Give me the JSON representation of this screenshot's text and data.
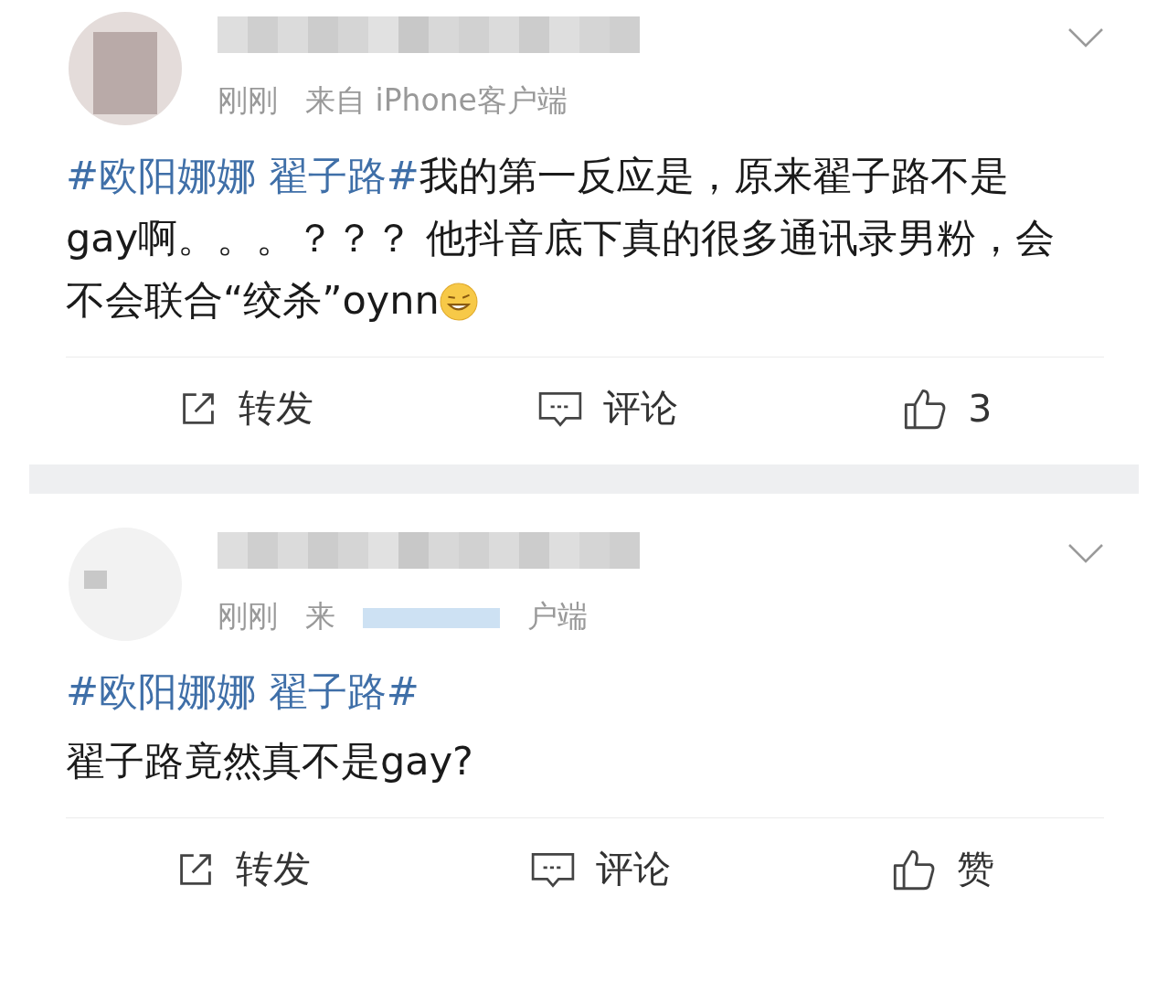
{
  "posts": [
    {
      "time": "刚刚",
      "source": [
        {
          "kind": "text",
          "text": "来自 iPhone客户端"
        }
      ],
      "body": [
        {
          "kind": "topic",
          "text": "#欧阳娜娜 翟子路#"
        },
        {
          "kind": "text",
          "text": "我的第一反应是，原来翟子路不是gay啊。。。？？？ 他抖音底下真的很多通讯录男粉，会不会联合“绞杀”oynn"
        },
        {
          "kind": "emoji"
        }
      ],
      "actions": {
        "repost": "转发",
        "comment": "评论",
        "like": "3"
      }
    },
    {
      "time": "刚刚",
      "source": [
        {
          "kind": "text",
          "text": "来"
        },
        {
          "kind": "blur"
        },
        {
          "kind": "text",
          "text": "户端"
        }
      ],
      "body": [
        {
          "kind": "topic",
          "text": "#欧阳娜娜 翟子路#"
        },
        {
          "kind": "break"
        },
        {
          "kind": "text",
          "text": "翟子路竟然真不是gay?"
        }
      ],
      "actions": {
        "repost": "转发",
        "comment": "评论",
        "like": "赞"
      }
    }
  ]
}
